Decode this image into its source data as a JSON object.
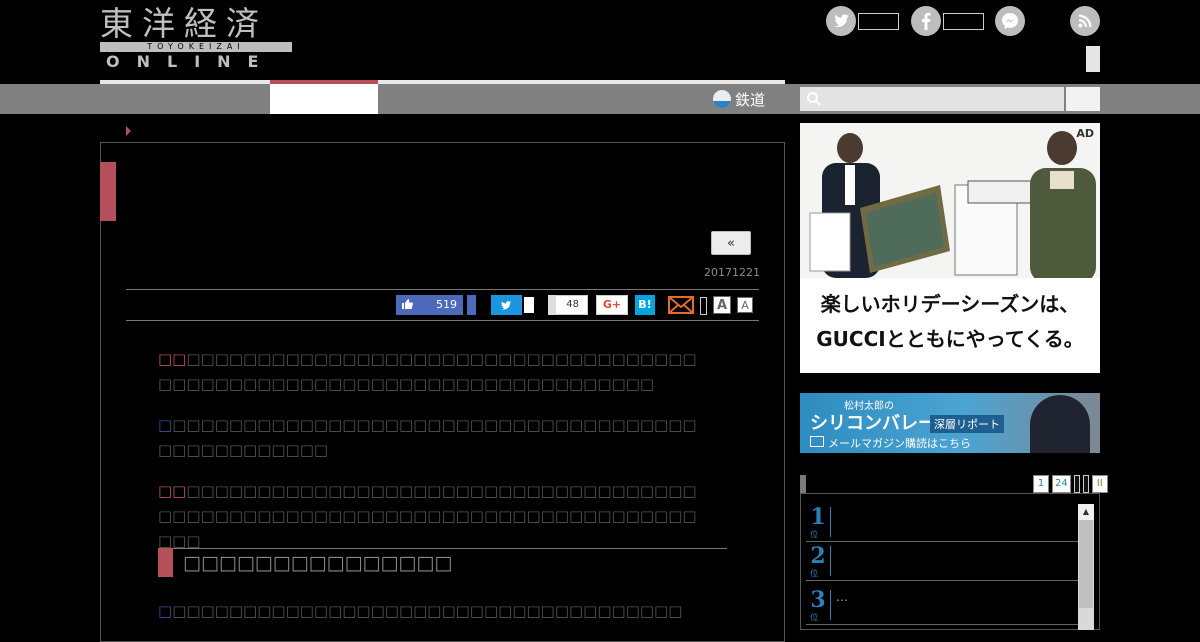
{
  "header": {
    "logo_kanji": "東洋経済",
    "logo_romaji": "TOYOKEIZAI",
    "logo_online": "ONLINE",
    "social": [
      {
        "name": "twitter",
        "glyph": "t"
      },
      {
        "name": "facebook",
        "glyph": "f"
      },
      {
        "name": "messenger",
        "glyph": "~"
      },
      {
        "name": "rss",
        "glyph": ")"
      }
    ]
  },
  "nav": {
    "rail_label": "鉄道",
    "search_placeholder": ""
  },
  "article": {
    "back_label": "«",
    "date": "20171221",
    "share": {
      "like_count": "519",
      "hatena_count": "48",
      "gplus_label": "G+",
      "hatebu_label": "B!",
      "font_large": "A",
      "font_small": "A"
    },
    "paragraphs": [
      {
        "lead": "□□",
        "lead_color": "red",
        "body": "□□□□□□□□□□□□□□□□□□□□□□□□□□□□□□□□□□□□□□□□□□□□□□□□□□□□□□□□□□□□□□□□□□□□□□□"
      },
      {
        "lead": "□",
        "lead_color": "blue",
        "body": "□□□□□□□□□□□□□□□□□□□□□□□□□□□□□□□□□□□□□□□□□□□□□□□□□"
      },
      {
        "lead": "□□",
        "lead_color": "red",
        "body": "□□□□□□□□□□□□□□□□□□□□□□□□□□□□□□□□□□□□□□□□□□□□□□□□□□□□□□□□□□□□□□□□□□□□□□□□□□□□□"
      }
    ],
    "subheading": "□□□□□□□□□□□□□□□",
    "paragraph4": {
      "lead": "□",
      "lead_color": "blue",
      "body": "□□□□□□□□□□□□□□□□□□□□□□□□□□□□□□□□□□□□"
    }
  },
  "sidebar": {
    "ad": {
      "badge": "AD",
      "line1": "楽しいホリデーシーズンは、",
      "line2": "GUCCIとともにやってくる。"
    },
    "banner": {
      "top": "松村太郎の",
      "title": "シリコンバレー",
      "tag": "深層リポート",
      "cta": "メールマガジン購読はこちら"
    },
    "ranking": {
      "tabs": [
        "1",
        "24",
        "",
        "",
        "II"
      ],
      "items": [
        {
          "num": "1",
          "sub": "位",
          "text": ""
        },
        {
          "num": "2",
          "sub": "位",
          "text": ""
        },
        {
          "num": "3",
          "sub": "位",
          "text": "…"
        }
      ]
    }
  }
}
